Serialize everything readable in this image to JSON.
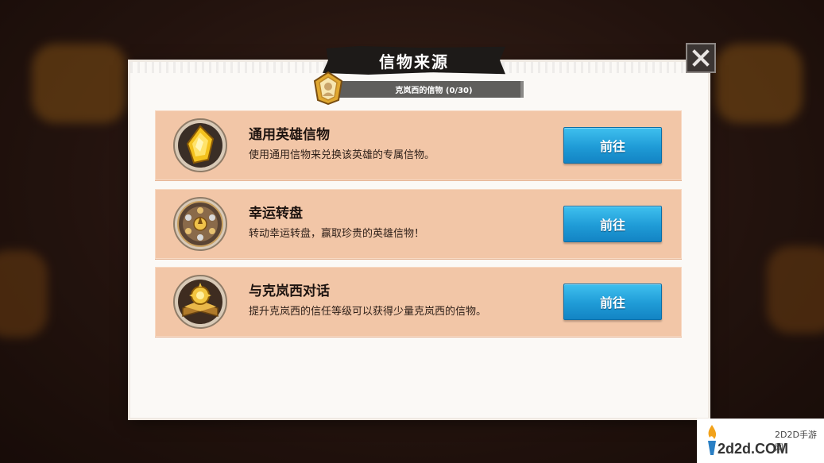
{
  "dialog": {
    "title": "信物来源",
    "subtitle": "克岚西的信物 (0/30)",
    "close_icon": "close-icon"
  },
  "sources": [
    {
      "title": "通用英雄信物",
      "description": "使用通用信物来兑换该英雄的专属信物。",
      "button_label": "前往",
      "icon": "gold-crystal-icon"
    },
    {
      "title": "幸运转盘",
      "description": "转动幸运转盘，赢取珍贵的英雄信物！",
      "button_label": "前往",
      "icon": "lucky-wheel-icon"
    },
    {
      "title": "与克岚西对话",
      "description": "提升克岚西的信任等级可以获得少量克岚西的信物。",
      "button_label": "前往",
      "icon": "gold-book-icon"
    }
  ],
  "watermark": {
    "chinese": "2D2D手游网",
    "site": "2d2d.COM"
  },
  "colors": {
    "row_bg": "#f2c6a7",
    "button_blue": "#1f9bd6",
    "panel_bg": "#fbf9f6",
    "banner_dark": "#1d1a18"
  }
}
